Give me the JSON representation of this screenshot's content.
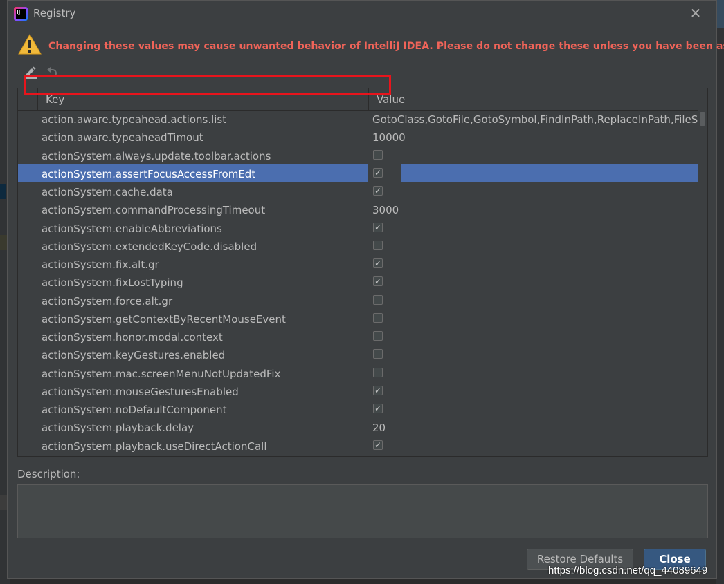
{
  "window": {
    "title": "Registry",
    "app_icon_label": "IJ"
  },
  "warning": {
    "text": "Changing these values may cause unwanted behavior of IntelliJ IDEA. Please do not change these unless you have been asked.",
    "color": "#f06459"
  },
  "toolbar": {
    "edit_icon": "pencil-edit-icon",
    "revert_icon": "undo-icon"
  },
  "table": {
    "columns": [
      "Key",
      "Value"
    ],
    "rows": [
      {
        "key": "action.aware.typeahead.actions.list",
        "type": "text",
        "value": "GotoClass,GotoFile,GotoSymbol,FindInPath,ReplaceInPath,FileStr"
      },
      {
        "key": "action.aware.typeaheadTimout",
        "type": "text",
        "value": "10000"
      },
      {
        "key": "actionSystem.always.update.toolbar.actions",
        "type": "bool",
        "checked": false
      },
      {
        "key": "actionSystem.assertFocusAccessFromEdt",
        "type": "bool",
        "checked": true,
        "selected": true
      },
      {
        "key": "actionSystem.cache.data",
        "type": "bool",
        "checked": true
      },
      {
        "key": "actionSystem.commandProcessingTimeout",
        "type": "text",
        "value": "3000"
      },
      {
        "key": "actionSystem.enableAbbreviations",
        "type": "bool",
        "checked": true
      },
      {
        "key": "actionSystem.extendedKeyCode.disabled",
        "type": "bool",
        "checked": false
      },
      {
        "key": "actionSystem.fix.alt.gr",
        "type": "bool",
        "checked": true
      },
      {
        "key": "actionSystem.fixLostTyping",
        "type": "bool",
        "checked": true
      },
      {
        "key": "actionSystem.force.alt.gr",
        "type": "bool",
        "checked": false
      },
      {
        "key": "actionSystem.getContextByRecentMouseEvent",
        "type": "bool",
        "checked": false
      },
      {
        "key": "actionSystem.honor.modal.context",
        "type": "bool",
        "checked": false
      },
      {
        "key": "actionSystem.keyGestures.enabled",
        "type": "bool",
        "checked": false
      },
      {
        "key": "actionSystem.mac.screenMenuNotUpdatedFix",
        "type": "bool",
        "checked": false
      },
      {
        "key": "actionSystem.mouseGesturesEnabled",
        "type": "bool",
        "checked": true
      },
      {
        "key": "actionSystem.noDefaultComponent",
        "type": "bool",
        "checked": true
      },
      {
        "key": "actionSystem.playback.delay",
        "type": "text",
        "value": "20"
      },
      {
        "key": "actionSystem.playback.useDirectActionCall",
        "type": "bool",
        "checked": true
      }
    ]
  },
  "description": {
    "label": "Description:",
    "value": ""
  },
  "buttons": {
    "restore_defaults": "Restore Defaults",
    "close": "Close"
  },
  "watermark": "https://blog.csdn.net/qq_44089649",
  "colors": {
    "dialog_bg": "#3c3f41",
    "selection": "#4b6eaf",
    "highlight_box": "#e8141c",
    "primary_button": "#365880"
  }
}
